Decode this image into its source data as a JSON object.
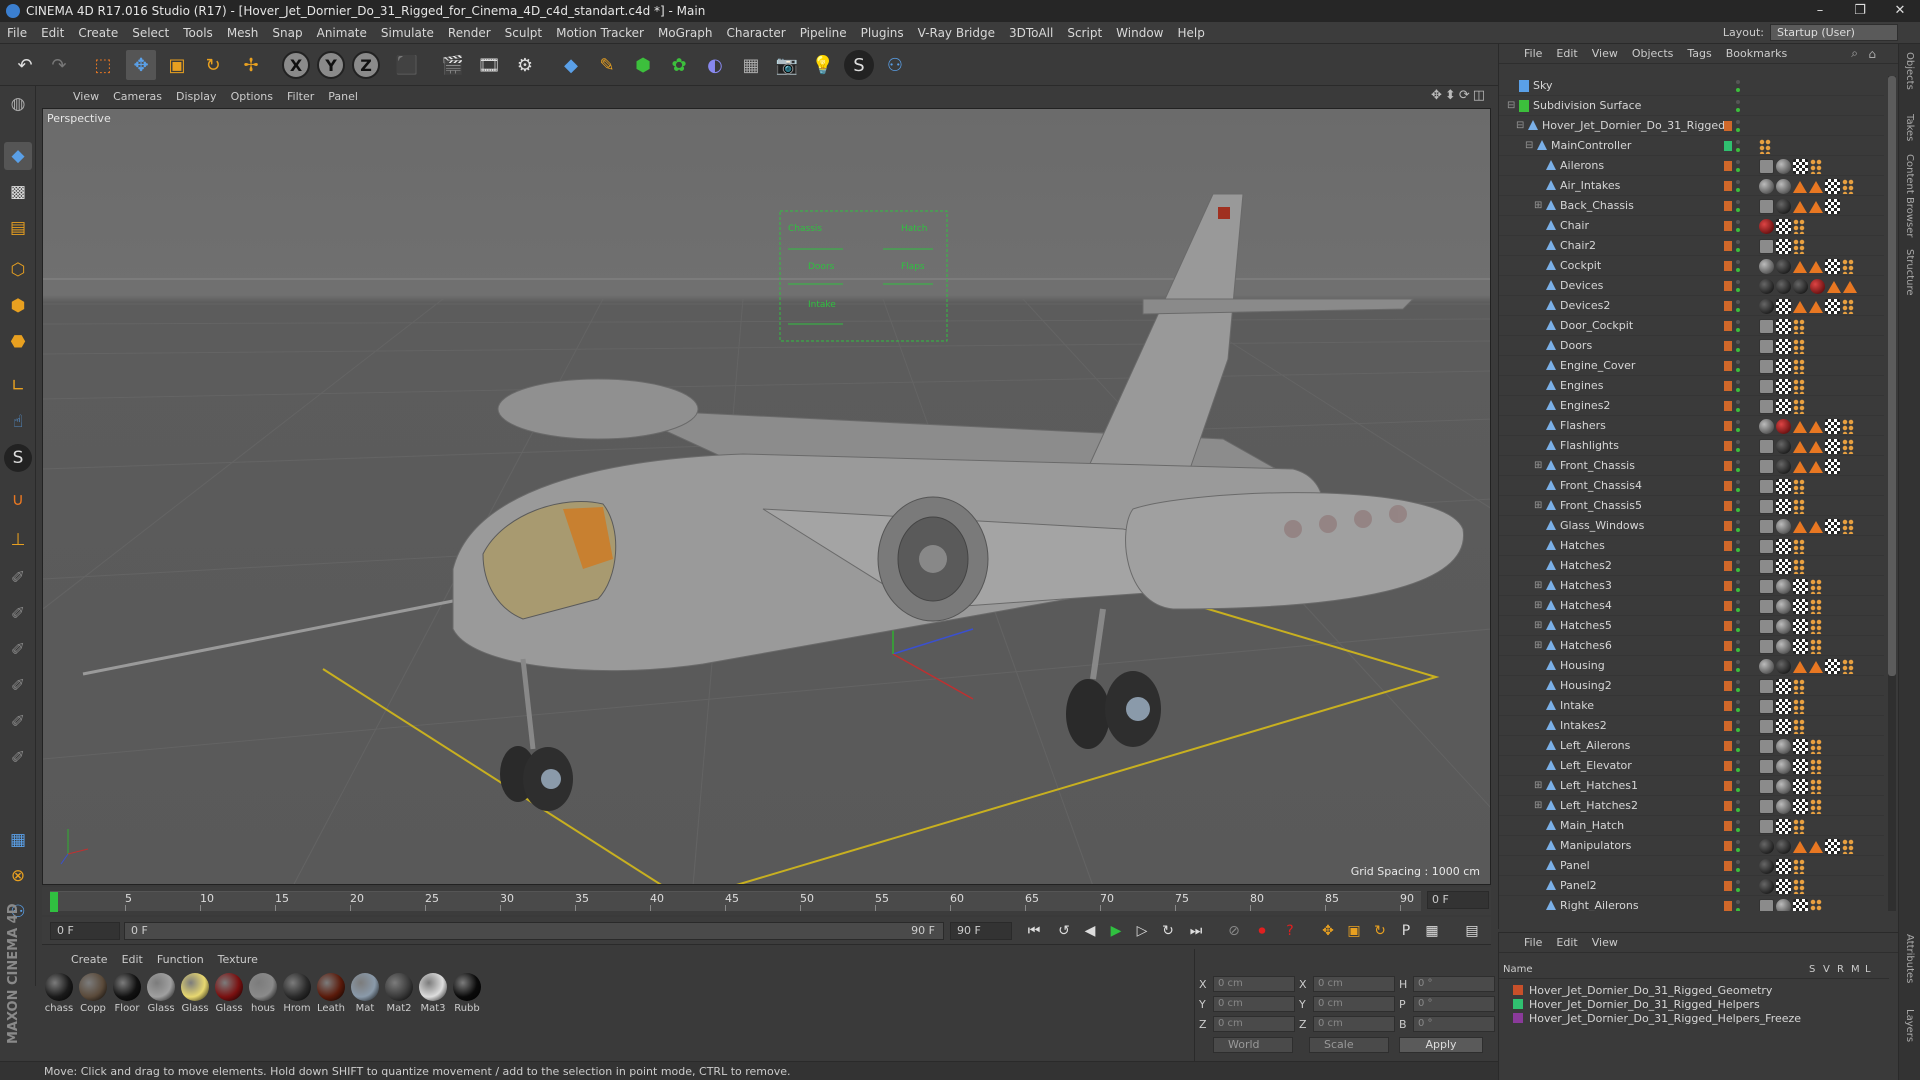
{
  "window": {
    "title": "CINEMA 4D R17.016 Studio (R17) - [Hover_Jet_Dornier_Do_31_Rigged_for_Cinema_4D_c4d_standart.c4d *] - Main",
    "controls": [
      "–",
      "❐",
      "✕"
    ]
  },
  "menu": [
    "File",
    "Edit",
    "Create",
    "Select",
    "Tools",
    "Mesh",
    "Snap",
    "Animate",
    "Simulate",
    "Render",
    "Sculpt",
    "Motion Tracker",
    "MoGraph",
    "Character",
    "Pipeline",
    "Plugins",
    "V-Ray Bridge",
    "3DToAll",
    "Script",
    "Window",
    "Help"
  ],
  "layout": {
    "label": "Layout:",
    "value": "Startup (User)"
  },
  "viewport": {
    "menu": [
      "View",
      "Cameras",
      "Display",
      "Options",
      "Filter",
      "Panel"
    ],
    "label": "Perspective",
    "grid_spacing": "Grid Spacing : 1000 cm"
  },
  "timeline": {
    "ticks": [
      "0",
      "5",
      "10",
      "15",
      "20",
      "25",
      "30",
      "35",
      "40",
      "45",
      "50",
      "55",
      "60",
      "65",
      "70",
      "75",
      "80",
      "85",
      "90"
    ],
    "current_frame": "0 F"
  },
  "transport": {
    "start": "0 F",
    "range_start": "0 F",
    "range_end": "90 F",
    "end": "90 F"
  },
  "materials": {
    "menu": [
      "Create",
      "Edit",
      "Function",
      "Texture"
    ],
    "items": [
      {
        "name": "chass",
        "color": "#1a1a1a"
      },
      {
        "name": "Copp",
        "color": "#5a4a3a"
      },
      {
        "name": "Floor",
        "color": "#111111"
      },
      {
        "name": "Glass",
        "color": "#a0a0a0"
      },
      {
        "name": "Glass",
        "color": "#e8d870"
      },
      {
        "name": "Glass",
        "color": "#7a1010"
      },
      {
        "name": "hous",
        "color": "#8a8a8a"
      },
      {
        "name": "Hrom",
        "color": "#2a2a2a"
      },
      {
        "name": "Leath",
        "color": "#5a1a0a"
      },
      {
        "name": "Mat",
        "color": "#8a9aaa"
      },
      {
        "name": "Mat2",
        "color": "#3a3a3a"
      },
      {
        "name": "Mat3",
        "color": "#dddddd"
      },
      {
        "name": "Rubb",
        "color": "#0a0a0a"
      }
    ]
  },
  "coords": {
    "rows": [
      {
        "a": "X",
        "av": "0 cm",
        "b": "X",
        "bv": "0 cm",
        "c": "H",
        "cv": "0 °"
      },
      {
        "a": "Y",
        "av": "0 cm",
        "b": "Y",
        "bv": "0 cm",
        "c": "P",
        "cv": "0 °"
      },
      {
        "a": "Z",
        "av": "0 cm",
        "b": "Z",
        "bv": "0 cm",
        "c": "B",
        "cv": "0 °"
      }
    ],
    "mode1": "World",
    "mode2": "Scale",
    "apply": "Apply"
  },
  "status": "Move: Click and drag to move elements. Hold down SHIFT to quantize movement / add to the selection in point mode, CTRL to remove.",
  "object_manager": {
    "menu": [
      "File",
      "Edit",
      "View",
      "Objects",
      "Tags",
      "Bookmarks"
    ],
    "objects": [
      {
        "name": "Sky",
        "depth": 0,
        "exp": "",
        "tags": []
      },
      {
        "name": "Subdivision Surface",
        "depth": 0,
        "exp": "−",
        "tags": []
      },
      {
        "name": "Hover_Jet_Dornier_Do_31_Rigged",
        "depth": 1,
        "exp": "−",
        "tags": []
      },
      {
        "name": "MainController",
        "depth": 2,
        "exp": "−",
        "tags": [
          "dots"
        ]
      },
      {
        "name": "Ailerons",
        "depth": 3,
        "exp": "",
        "tags": [
          "phong",
          "mat",
          "tex",
          "dots"
        ]
      },
      {
        "name": "Air_Intakes",
        "depth": 3,
        "exp": "",
        "tags": [
          "mat",
          "mat",
          "tri",
          "tri",
          "tex",
          "dots"
        ]
      },
      {
        "name": "Back_Chassis",
        "depth": 3,
        "exp": "+",
        "tags": [
          "phong",
          "dark",
          "tri",
          "tri",
          "tex"
        ]
      },
      {
        "name": "Chair",
        "depth": 3,
        "exp": "",
        "tags": [
          "red",
          "tex",
          "dots"
        ]
      },
      {
        "name": "Chair2",
        "depth": 3,
        "exp": "",
        "tags": [
          "phong",
          "tex",
          "dots"
        ]
      },
      {
        "name": "Cockpit",
        "depth": 3,
        "exp": "",
        "tags": [
          "mat",
          "dark",
          "tri",
          "tri",
          "tex",
          "dots"
        ]
      },
      {
        "name": "Devices",
        "depth": 3,
        "exp": "",
        "tags": [
          "dark",
          "dark",
          "dark",
          "red",
          "tri",
          "tri"
        ]
      },
      {
        "name": "Devices2",
        "depth": 3,
        "exp": "",
        "tags": [
          "dark",
          "tex",
          "tri",
          "tri",
          "tex",
          "dots"
        ]
      },
      {
        "name": "Door_Cockpit",
        "depth": 3,
        "exp": "",
        "tags": [
          "phong",
          "tex",
          "dots"
        ]
      },
      {
        "name": "Doors",
        "depth": 3,
        "exp": "",
        "tags": [
          "phong",
          "tex",
          "dots"
        ]
      },
      {
        "name": "Engine_Cover",
        "depth": 3,
        "exp": "",
        "tags": [
          "phong",
          "tex",
          "dots"
        ]
      },
      {
        "name": "Engines",
        "depth": 3,
        "exp": "",
        "tags": [
          "phong",
          "tex",
          "dots"
        ]
      },
      {
        "name": "Engines2",
        "depth": 3,
        "exp": "",
        "tags": [
          "phong",
          "tex",
          "dots"
        ]
      },
      {
        "name": "Flashers",
        "depth": 3,
        "exp": "",
        "tags": [
          "mat",
          "red",
          "tri",
          "tri",
          "tex",
          "dots"
        ]
      },
      {
        "name": "Flashlights",
        "depth": 3,
        "exp": "",
        "tags": [
          "phong",
          "dark",
          "tri",
          "tri",
          "tex",
          "dots"
        ]
      },
      {
        "name": "Front_Chassis",
        "depth": 3,
        "exp": "+",
        "tags": [
          "phong",
          "dark",
          "tri",
          "tri",
          "tex"
        ]
      },
      {
        "name": "Front_Chassis4",
        "depth": 3,
        "exp": "",
        "tags": [
          "phong",
          "tex",
          "dots"
        ]
      },
      {
        "name": "Front_Chassis5",
        "depth": 3,
        "exp": "+",
        "tags": [
          "phong",
          "tex",
          "dots"
        ]
      },
      {
        "name": "Glass_Windows",
        "depth": 3,
        "exp": "",
        "tags": [
          "phong",
          "mat",
          "tri",
          "tri",
          "tex",
          "dots"
        ]
      },
      {
        "name": "Hatches",
        "depth": 3,
        "exp": "",
        "tags": [
          "phong",
          "tex",
          "dots"
        ]
      },
      {
        "name": "Hatches2",
        "depth": 3,
        "exp": "",
        "tags": [
          "phong",
          "tex",
          "dots"
        ]
      },
      {
        "name": "Hatches3",
        "depth": 3,
        "exp": "+",
        "tags": [
          "phong",
          "mat",
          "tex",
          "dots"
        ]
      },
      {
        "name": "Hatches4",
        "depth": 3,
        "exp": "+",
        "tags": [
          "phong",
          "mat",
          "tex",
          "dots"
        ]
      },
      {
        "name": "Hatches5",
        "depth": 3,
        "exp": "+",
        "tags": [
          "phong",
          "mat",
          "tex",
          "dots"
        ]
      },
      {
        "name": "Hatches6",
        "depth": 3,
        "exp": "+",
        "tags": [
          "phong",
          "mat",
          "tex",
          "dots"
        ]
      },
      {
        "name": "Housing",
        "depth": 3,
        "exp": "",
        "tags": [
          "mat",
          "dark",
          "tri",
          "tri",
          "tex",
          "dots"
        ]
      },
      {
        "name": "Housing2",
        "depth": 3,
        "exp": "",
        "tags": [
          "phong",
          "tex",
          "dots"
        ]
      },
      {
        "name": "Intake",
        "depth": 3,
        "exp": "",
        "tags": [
          "phong",
          "tex",
          "dots"
        ]
      },
      {
        "name": "Intakes2",
        "depth": 3,
        "exp": "",
        "tags": [
          "phong",
          "tex",
          "dots"
        ]
      },
      {
        "name": "Left_Ailerons",
        "depth": 3,
        "exp": "",
        "tags": [
          "phong",
          "mat",
          "tex",
          "dots"
        ]
      },
      {
        "name": "Left_Elevator",
        "depth": 3,
        "exp": "",
        "tags": [
          "phong",
          "mat",
          "tex",
          "dots"
        ]
      },
      {
        "name": "Left_Hatches1",
        "depth": 3,
        "exp": "+",
        "tags": [
          "phong",
          "mat",
          "tex",
          "dots"
        ]
      },
      {
        "name": "Left_Hatches2",
        "depth": 3,
        "exp": "+",
        "tags": [
          "phong",
          "mat",
          "tex",
          "dots"
        ]
      },
      {
        "name": "Main_Hatch",
        "depth": 3,
        "exp": "",
        "tags": [
          "phong",
          "tex",
          "dots"
        ]
      },
      {
        "name": "Manipulators",
        "depth": 3,
        "exp": "",
        "tags": [
          "dark",
          "dark",
          "tri",
          "tri",
          "tex",
          "dots"
        ]
      },
      {
        "name": "Panel",
        "depth": 3,
        "exp": "",
        "tags": [
          "dark",
          "tex",
          "dots"
        ]
      },
      {
        "name": "Panel2",
        "depth": 3,
        "exp": "",
        "tags": [
          "dark",
          "tex",
          "dots"
        ]
      },
      {
        "name": "Right_Ailerons",
        "depth": 3,
        "exp": "",
        "tags": [
          "phong",
          "mat",
          "tex",
          "dots"
        ]
      }
    ]
  },
  "layer_manager": {
    "menu": [
      "File",
      "Edit",
      "View"
    ],
    "header": {
      "name": "Name",
      "cols": [
        "S",
        "V",
        "R",
        "M",
        "L"
      ]
    },
    "layers": [
      {
        "name": "Hover_Jet_Dornier_Do_31_Rigged_Geometry",
        "color": "#c8502a"
      },
      {
        "name": "Hover_Jet_Dornier_Do_31_Rigged_Helpers",
        "color": "#30c070"
      },
      {
        "name": "Hover_Jet_Dornier_Do_31_Rigged_Helpers_Freeze",
        "color": "#8a3a9a"
      }
    ]
  },
  "side_tabs": [
    "Objects",
    "Takes",
    "Content Browser",
    "Structure",
    "Attributes",
    "Layers"
  ],
  "brand": "MAXON CINEMA 4D",
  "colors": {
    "accent_orange": "#e87722",
    "selection_green": "#3cbf3c",
    "viewport_bg": "#5c5c5c"
  }
}
